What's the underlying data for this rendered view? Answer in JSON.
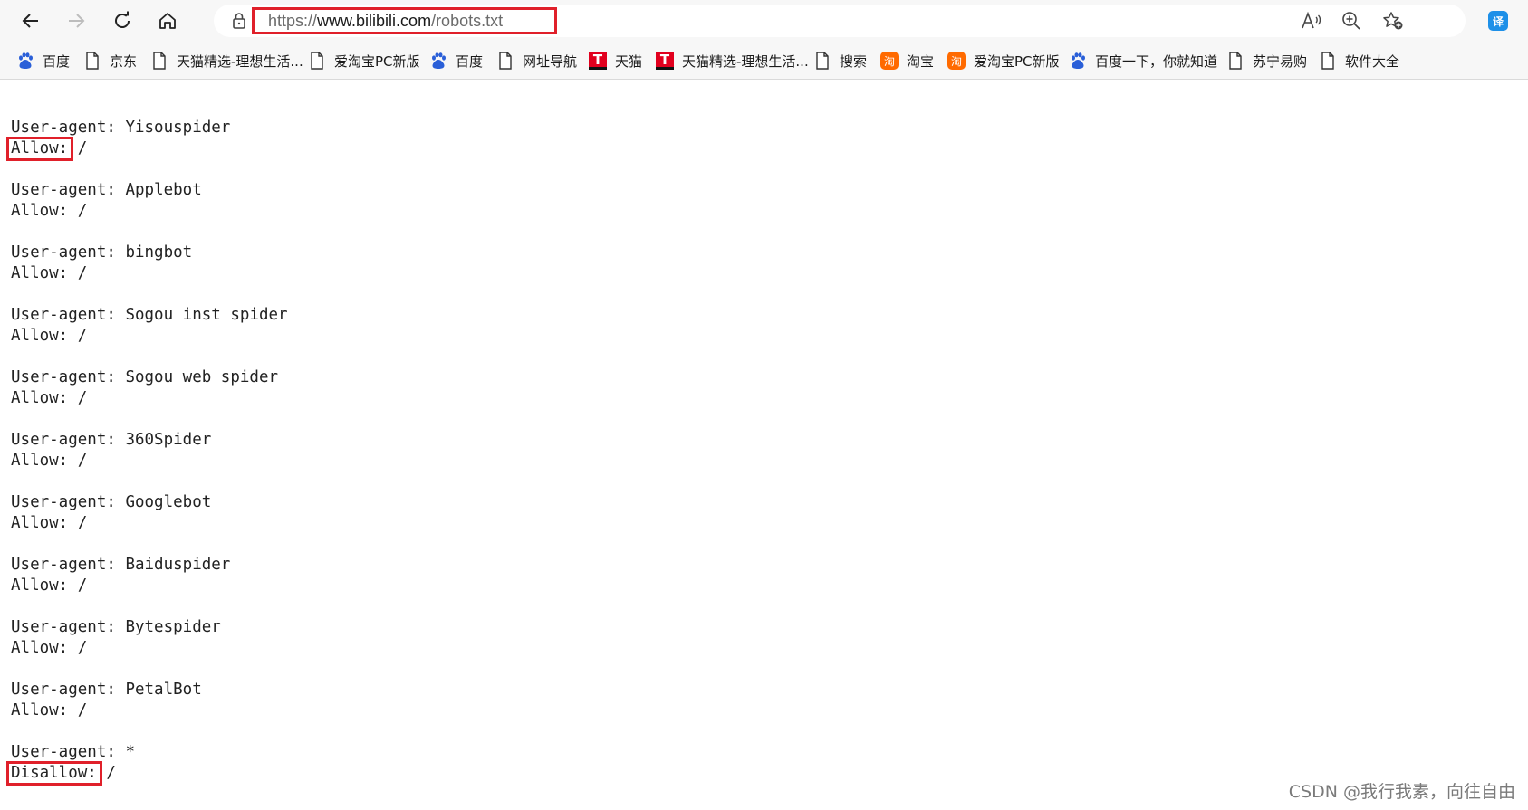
{
  "browser": {
    "url": {
      "protocol": "https://",
      "host": "www.bilibili.com",
      "path": "/robots.txt"
    },
    "bookmarks": [
      {
        "label": "百度",
        "icon": "baidu-paw-icon"
      },
      {
        "label": "京东",
        "icon": "page-icon"
      },
      {
        "label": "天猫精选-理想生活...",
        "icon": "page-icon"
      },
      {
        "label": "爱淘宝PC新版",
        "icon": "page-icon"
      },
      {
        "label": "百度",
        "icon": "baidu-paw-icon"
      },
      {
        "label": "网址导航",
        "icon": "page-icon"
      },
      {
        "label": "天猫",
        "icon": "tmall-icon"
      },
      {
        "label": "天猫精选-理想生活...",
        "icon": "tmall-icon"
      },
      {
        "label": "搜索",
        "icon": "page-icon"
      },
      {
        "label": "淘宝",
        "icon": "taobao-icon"
      },
      {
        "label": "爱淘宝PC新版",
        "icon": "taobao-icon"
      },
      {
        "label": "百度一下，你就知道",
        "icon": "baidu-paw-icon"
      },
      {
        "label": "苏宁易购",
        "icon": "page-icon"
      },
      {
        "label": "软件大全",
        "icon": "page-icon"
      }
    ],
    "tmall_letter": "T",
    "taobao_letter": "淘",
    "extension_letter": "译",
    "colors": {
      "highlight": "#e0202a",
      "toolbar": "#f7f7f7",
      "baidu": "#2a5fd8"
    }
  },
  "robots": {
    "records": [
      {
        "ua_key": "User-agent:",
        "agent": "Yisouspider",
        "rule_key": "Allow:",
        "rule_value": "/"
      },
      {
        "ua_key": "User-agent:",
        "agent": "Applebot",
        "rule_key": "Allow:",
        "rule_value": "/"
      },
      {
        "ua_key": "User-agent:",
        "agent": "bingbot",
        "rule_key": "Allow:",
        "rule_value": "/"
      },
      {
        "ua_key": "User-agent:",
        "agent": "Sogou inst spider",
        "rule_key": "Allow:",
        "rule_value": "/"
      },
      {
        "ua_key": "User-agent:",
        "agent": "Sogou web spider",
        "rule_key": "Allow:",
        "rule_value": "/"
      },
      {
        "ua_key": "User-agent:",
        "agent": "360Spider",
        "rule_key": "Allow:",
        "rule_value": "/"
      },
      {
        "ua_key": "User-agent:",
        "agent": "Googlebot",
        "rule_key": "Allow:",
        "rule_value": "/"
      },
      {
        "ua_key": "User-agent:",
        "agent": "Baiduspider",
        "rule_key": "Allow:",
        "rule_value": "/"
      },
      {
        "ua_key": "User-agent:",
        "agent": "Bytespider",
        "rule_key": "Allow:",
        "rule_value": "/"
      },
      {
        "ua_key": "User-agent:",
        "agent": "PetalBot",
        "rule_key": "Allow:",
        "rule_value": "/"
      },
      {
        "ua_key": "User-agent:",
        "agent": "*",
        "rule_key": "Disallow:",
        "rule_value": "/"
      }
    ]
  },
  "watermark": "CSDN @我行我素，向往自由"
}
